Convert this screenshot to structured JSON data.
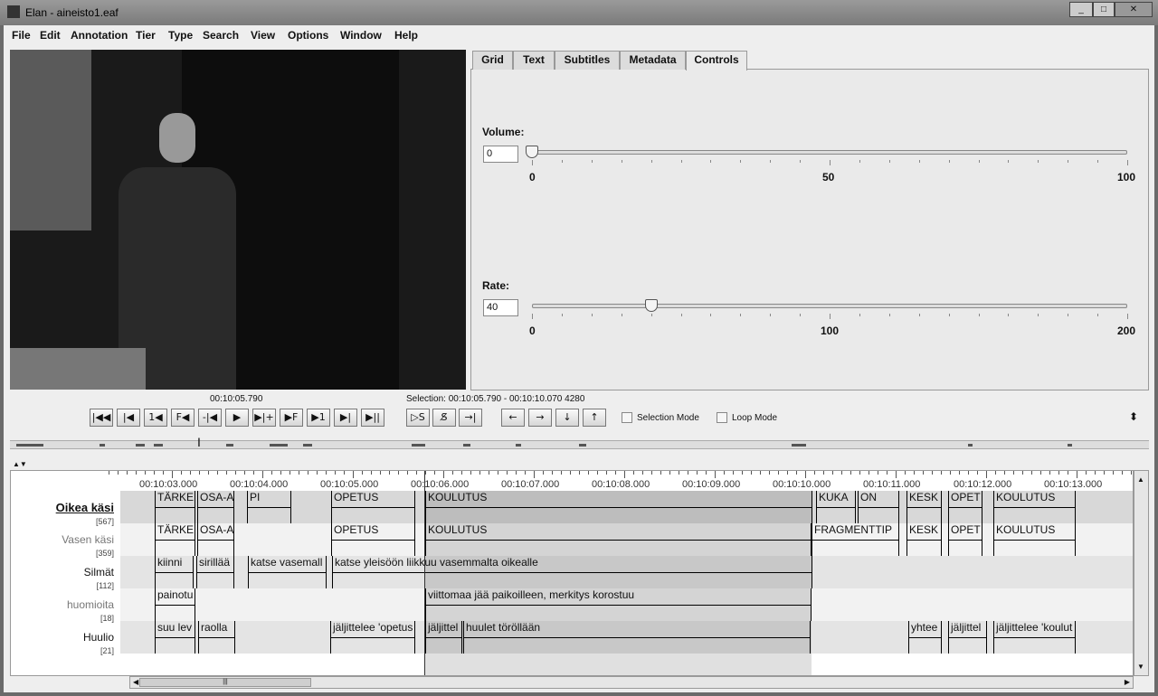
{
  "window": {
    "title": "Elan - aineisto1.eaf"
  },
  "menu": [
    "File",
    "Edit",
    "Annotation",
    "Tier",
    "Type",
    "Search",
    "View",
    "Options",
    "Window",
    "Help"
  ],
  "tabs": [
    "Grid",
    "Text",
    "Subtitles",
    "Metadata",
    "Controls"
  ],
  "active_tab": "Controls",
  "controls": {
    "volume": {
      "label": "Volume:",
      "value": "0",
      "min": "0",
      "mid": "50",
      "max": "100",
      "fraction": 0
    },
    "rate": {
      "label": "Rate:",
      "value": "40",
      "min": "0",
      "mid": "100",
      "max": "200",
      "fraction": 0.2
    }
  },
  "player": {
    "current_time": "00:10:05.790",
    "selection": "Selection: 00:10:05.790 - 00:10:10.070  4280"
  },
  "buttons": [
    {
      "name": "go-to-begin",
      "glyph": "|◀◀"
    },
    {
      "name": "previous-second",
      "glyph": "|◀"
    },
    {
      "name": "previous-frame",
      "glyph": "1◀"
    },
    {
      "name": "previous-pixel",
      "glyph": "F◀"
    },
    {
      "name": "previous-boundary",
      "glyph": "-|◀"
    },
    {
      "name": "play",
      "glyph": "▶"
    },
    {
      "name": "next-boundary",
      "glyph": "▶|+"
    },
    {
      "name": "next-pixel",
      "glyph": "▶F"
    },
    {
      "name": "next-frame",
      "glyph": "▶1"
    },
    {
      "name": "next-second",
      "glyph": "▶|"
    },
    {
      "name": "go-to-end",
      "glyph": "▶||"
    }
  ],
  "selection_buttons": [
    {
      "name": "play-selection",
      "glyph": "▷S"
    },
    {
      "name": "clear-selection",
      "glyph": "S̸"
    },
    {
      "name": "toggle-crosshair",
      "glyph": "→|"
    }
  ],
  "nav_buttons": [
    {
      "name": "left",
      "glyph": "←"
    },
    {
      "name": "right",
      "glyph": "→"
    },
    {
      "name": "down",
      "glyph": "↓"
    },
    {
      "name": "up",
      "glyph": "↑"
    }
  ],
  "checkboxes": {
    "selection_mode": "Selection Mode",
    "loop_mode": "Loop Mode"
  },
  "timeline": {
    "ruler_labels": [
      "00:10:03.000",
      "00:10:04.000",
      "00:10:05.000",
      "00:10:06.000",
      "00:10:07.000",
      "00:10:08.000",
      "00:10:09.000",
      "00:10:10.000",
      "00:10:11.000",
      "00:10:12.000",
      "00:10:13.000"
    ],
    "ruler_seconds": [
      3,
      4,
      5,
      6,
      7,
      8,
      9,
      10,
      11,
      12,
      13
    ],
    "crosshair": 5.79,
    "selection": [
      5.79,
      10.07
    ],
    "tiers": [
      {
        "name": "Oikea käsi",
        "count": "[567]",
        "active": true,
        "annotations": [
          {
            "text": "TÄRKE",
            "start": 2.81,
            "end": 3.26
          },
          {
            "text": "OSA-A",
            "start": 3.28,
            "end": 3.69
          },
          {
            "text": "PI",
            "start": 3.83,
            "end": 4.32
          },
          {
            "text": "OPETUS",
            "start": 4.76,
            "end": 5.69
          },
          {
            "text": "KOULUTUS",
            "start": 5.8,
            "end": 10.08
          },
          {
            "text": "KUKA",
            "start": 10.12,
            "end": 10.56
          },
          {
            "text": "ON",
            "start": 10.58,
            "end": 11.04
          },
          {
            "text": "KESK",
            "start": 11.12,
            "end": 11.51
          },
          {
            "text": "OPET",
            "start": 11.58,
            "end": 11.96
          },
          {
            "text": "KOULUTUS",
            "start": 12.08,
            "end": 12.99
          }
        ]
      },
      {
        "name": "Vasen käsi",
        "count": "[359]",
        "active": false,
        "annotations": [
          {
            "text": "TÄRKE",
            "start": 2.81,
            "end": 3.26
          },
          {
            "text": "OSA-A",
            "start": 3.28,
            "end": 3.69
          },
          {
            "text": "OPETUS",
            "start": 4.76,
            "end": 5.69
          },
          {
            "text": "KOULUTUS",
            "start": 5.8,
            "end": 10.07
          },
          {
            "text": "FRAGMENTTIP",
            "start": 10.07,
            "end": 11.04
          },
          {
            "text": "KESK",
            "start": 11.12,
            "end": 11.51
          },
          {
            "text": "OPET",
            "start": 11.58,
            "end": 11.96
          },
          {
            "text": "KOULUTUS",
            "start": 12.08,
            "end": 12.99
          }
        ]
      },
      {
        "name": "Silmät",
        "count": "[112]",
        "active": false,
        "annotations": [
          {
            "text": "kiinni",
            "start": 2.81,
            "end": 3.24
          },
          {
            "text": "sirillää",
            "start": 3.27,
            "end": 3.69
          },
          {
            "text": "katse vasemall",
            "start": 3.84,
            "end": 4.71
          },
          {
            "text": "katse yleisöön liikkuu vasemmalta oikealle",
            "start": 4.77,
            "end": 10.08
          }
        ]
      },
      {
        "name": "huomioita",
        "count": "[18]",
        "active": false,
        "annotations": [
          {
            "text": "painotu",
            "start": 2.81,
            "end": 3.26
          },
          {
            "text": "viittomaa jää paikoilleen, merkitys korostuu",
            "start": 5.8,
            "end": 10.07
          }
        ]
      },
      {
        "name": "Huulio",
        "count": "[21]",
        "active": false,
        "annotations": [
          {
            "text": "suu lev",
            "start": 2.81,
            "end": 3.26
          },
          {
            "text": "raolla",
            "start": 3.29,
            "end": 3.7
          },
          {
            "text": "jäljittelee 'opetus",
            "start": 4.75,
            "end": 5.69
          },
          {
            "text": "jäljittel",
            "start": 5.8,
            "end": 6.21
          },
          {
            "text": "huulet töröllään",
            "start": 6.22,
            "end": 10.06
          },
          {
            "text": "yhtee",
            "start": 11.14,
            "end": 11.51
          },
          {
            "text": "jäljittel",
            "start": 11.58,
            "end": 12.01
          },
          {
            "text": "jäljittelee 'koulut",
            "start": 12.08,
            "end": 12.99
          }
        ]
      }
    ]
  }
}
